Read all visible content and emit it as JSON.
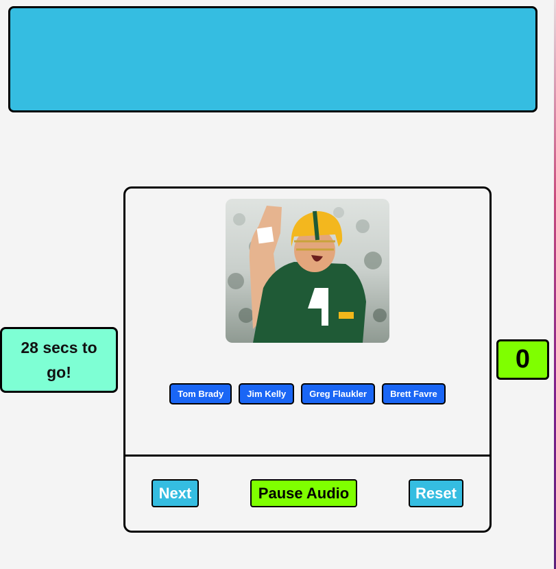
{
  "timer": {
    "text": "28 secs to go!"
  },
  "score": {
    "value": "0"
  },
  "quiz": {
    "image_subject": "football-player-photo",
    "choices": [
      "Tom Brady",
      "Jim Kelly",
      "Greg Flaukler",
      "Brett Favre"
    ]
  },
  "controls": {
    "next_label": "Next",
    "pause_label": "Pause Audio",
    "reset_label": "Reset"
  },
  "colors": {
    "banner": "#35bde1",
    "timer_bg": "#7effd4",
    "score_bg": "#7fff00",
    "choice_bg": "#1a66f5",
    "pause_bg": "#7fff00",
    "next_reset_bg": "#35bde1"
  }
}
